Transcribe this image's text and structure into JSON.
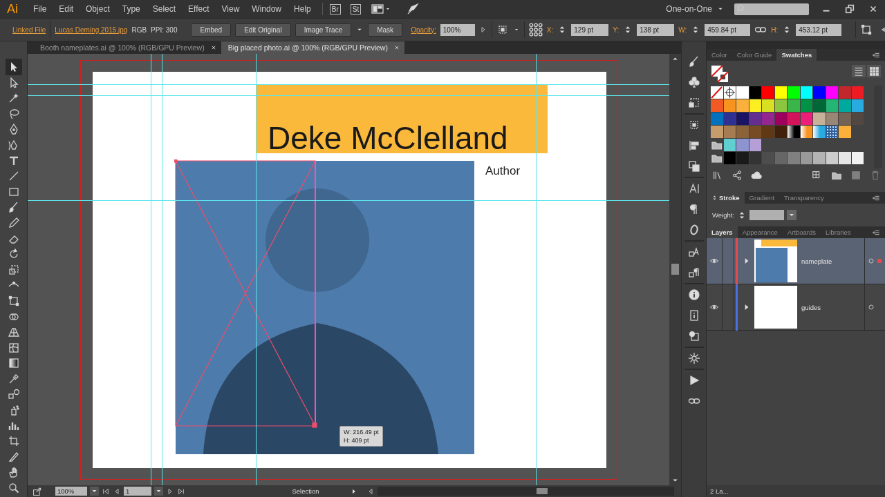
{
  "app": {
    "logo": "Ai",
    "menus": [
      "File",
      "Edit",
      "Object",
      "Type",
      "Select",
      "Effect",
      "View",
      "Window",
      "Help"
    ],
    "bridge_buttons": [
      "Br",
      "St"
    ],
    "workspace": "One-on-One"
  },
  "control_bar": {
    "linked_file": "Linked File",
    "file_name": "Lucas Deming 2015.jpg",
    "color_mode": "RGB",
    "ppi": "PPI: 300",
    "buttons": [
      "Embed",
      "Edit Original",
      "Image Trace",
      "Mask"
    ],
    "opacity_label": "Opacity:",
    "opacity": "100%",
    "fields": [
      {
        "label": "X:",
        "value": "129 pt"
      },
      {
        "label": "Y:",
        "value": "138 pt"
      },
      {
        "label": "W:",
        "value": "459.84 pt"
      },
      {
        "label": "H:",
        "value": "453.12 pt"
      }
    ]
  },
  "document_tabs": [
    {
      "title": "Booth nameplates.ai @ 100% (RGB/GPU Preview)",
      "selected": false
    },
    {
      "title": "Big placed photo.ai @ 100% (RGB/GPU Preview)",
      "selected": true
    }
  ],
  "artboard": {
    "heading": "Deke McClelland",
    "subtitle": "Author",
    "measure_tooltip": [
      "W: 216.49 pt",
      "H: 409 pt"
    ]
  },
  "swatch_panel": {
    "tabs": [
      {
        "label": "Color",
        "selected": false
      },
      {
        "label": "Color Guide",
        "selected": false
      },
      {
        "label": "Swatches",
        "selected": true
      }
    ],
    "rows": [
      [
        {
          "kind": "none"
        },
        {
          "kind": "registration"
        },
        {
          "kind": "solid",
          "color": "#ffffff"
        },
        {
          "kind": "solid",
          "color": "#000000"
        },
        {
          "kind": "solid",
          "color": "#ff0000"
        },
        {
          "kind": "solid",
          "color": "#ffff00"
        },
        {
          "kind": "solid",
          "color": "#00ff00"
        },
        {
          "kind": "solid",
          "color": "#00ffff"
        },
        {
          "kind": "solid",
          "color": "#0000ff"
        },
        {
          "kind": "solid",
          "color": "#ff00ff"
        },
        {
          "kind": "solid",
          "color": "#c1272d"
        },
        {
          "kind": "solid",
          "color": "#ed1c24"
        }
      ],
      [
        {
          "kind": "solid",
          "color": "#f15a24"
        },
        {
          "kind": "solid",
          "color": "#f7931e"
        },
        {
          "kind": "solid",
          "color": "#fbb03b"
        },
        {
          "kind": "solid",
          "color": "#fcee21"
        },
        {
          "kind": "solid",
          "color": "#d9e021"
        },
        {
          "kind": "solid",
          "color": "#8cc63f"
        },
        {
          "kind": "solid",
          "color": "#39b54a"
        },
        {
          "kind": "solid",
          "color": "#009245"
        },
        {
          "kind": "solid",
          "color": "#006837"
        },
        {
          "kind": "solid",
          "color": "#22b573"
        },
        {
          "kind": "solid",
          "color": "#00a99d"
        },
        {
          "kind": "solid",
          "color": "#29abe2"
        }
      ],
      [
        {
          "kind": "solid",
          "color": "#0071bc"
        },
        {
          "kind": "solid",
          "color": "#2e3192"
        },
        {
          "kind": "solid",
          "color": "#1b1464"
        },
        {
          "kind": "solid",
          "color": "#662d91"
        },
        {
          "kind": "solid",
          "color": "#93278f"
        },
        {
          "kind": "solid",
          "color": "#9e005d"
        },
        {
          "kind": "solid",
          "color": "#d4145a"
        },
        {
          "kind": "solid",
          "color": "#ed1e79"
        },
        {
          "kind": "solid",
          "color": "#c7b299"
        },
        {
          "kind": "solid",
          "color": "#998675"
        },
        {
          "kind": "solid",
          "color": "#736357"
        },
        {
          "kind": "solid",
          "color": "#534741"
        }
      ],
      [
        {
          "kind": "solid",
          "color": "#c69c6d"
        },
        {
          "kind": "solid",
          "color": "#a67c52"
        },
        {
          "kind": "solid",
          "color": "#8c6239"
        },
        {
          "kind": "solid",
          "color": "#754c24"
        },
        {
          "kind": "solid",
          "color": "#603813"
        },
        {
          "kind": "solid",
          "color": "#42210b"
        },
        {
          "kind": "gradient",
          "color": "#000000"
        },
        {
          "kind": "gradient",
          "color": "#f7931e"
        },
        {
          "kind": "gradient",
          "color": "#29abe2"
        },
        {
          "kind": "pattern",
          "color": "#2e5f9e"
        },
        {
          "kind": "solid",
          "color": "#fbb03b"
        }
      ]
    ],
    "groups": [
      [
        {
          "kind": "solid",
          "color": "#5fcfd0"
        },
        {
          "kind": "solid",
          "color": "#8c95d0"
        },
        {
          "kind": "solid",
          "color": "#b59fd6"
        }
      ],
      [
        {
          "kind": "solid",
          "color": "#000000"
        },
        {
          "kind": "solid",
          "color": "#1a1a1a"
        },
        {
          "kind": "solid",
          "color": "#333333"
        },
        {
          "kind": "solid",
          "color": "#4d4d4d"
        },
        {
          "kind": "solid",
          "color": "#666666"
        },
        {
          "kind": "solid",
          "color": "#808080"
        },
        {
          "kind": "solid",
          "color": "#999999"
        },
        {
          "kind": "solid",
          "color": "#b3b3b3"
        },
        {
          "kind": "solid",
          "color": "#cccccc"
        },
        {
          "kind": "solid",
          "color": "#e6e6e6"
        },
        {
          "kind": "solid",
          "color": "#f2f2f2"
        }
      ]
    ]
  },
  "stroke_panel": {
    "tabs": [
      {
        "label": "Stroke",
        "selected": true
      },
      {
        "label": "Gradient",
        "selected": false
      },
      {
        "label": "Transparency",
        "selected": false
      }
    ],
    "weight_label": "Weight:"
  },
  "layers_panel": {
    "tabs": [
      {
        "label": "Layers",
        "selected": true
      },
      {
        "label": "Appearance",
        "selected": false
      },
      {
        "label": "Artboards",
        "selected": false
      },
      {
        "label": "Libraries",
        "selected": false
      }
    ],
    "layers": [
      {
        "name": "nameplate",
        "color": "#e04b4b",
        "selected": true,
        "visible": true,
        "has_selected_art": true,
        "has_artwork": true
      },
      {
        "name": "guides",
        "color": "#4b6fe0",
        "selected": false,
        "visible": true,
        "has_selected_art": false,
        "has_artwork": false
      }
    ],
    "footer": "2 La..."
  },
  "status_bar": {
    "zoom": "100%",
    "artboard": "1",
    "tool": "Selection"
  }
}
